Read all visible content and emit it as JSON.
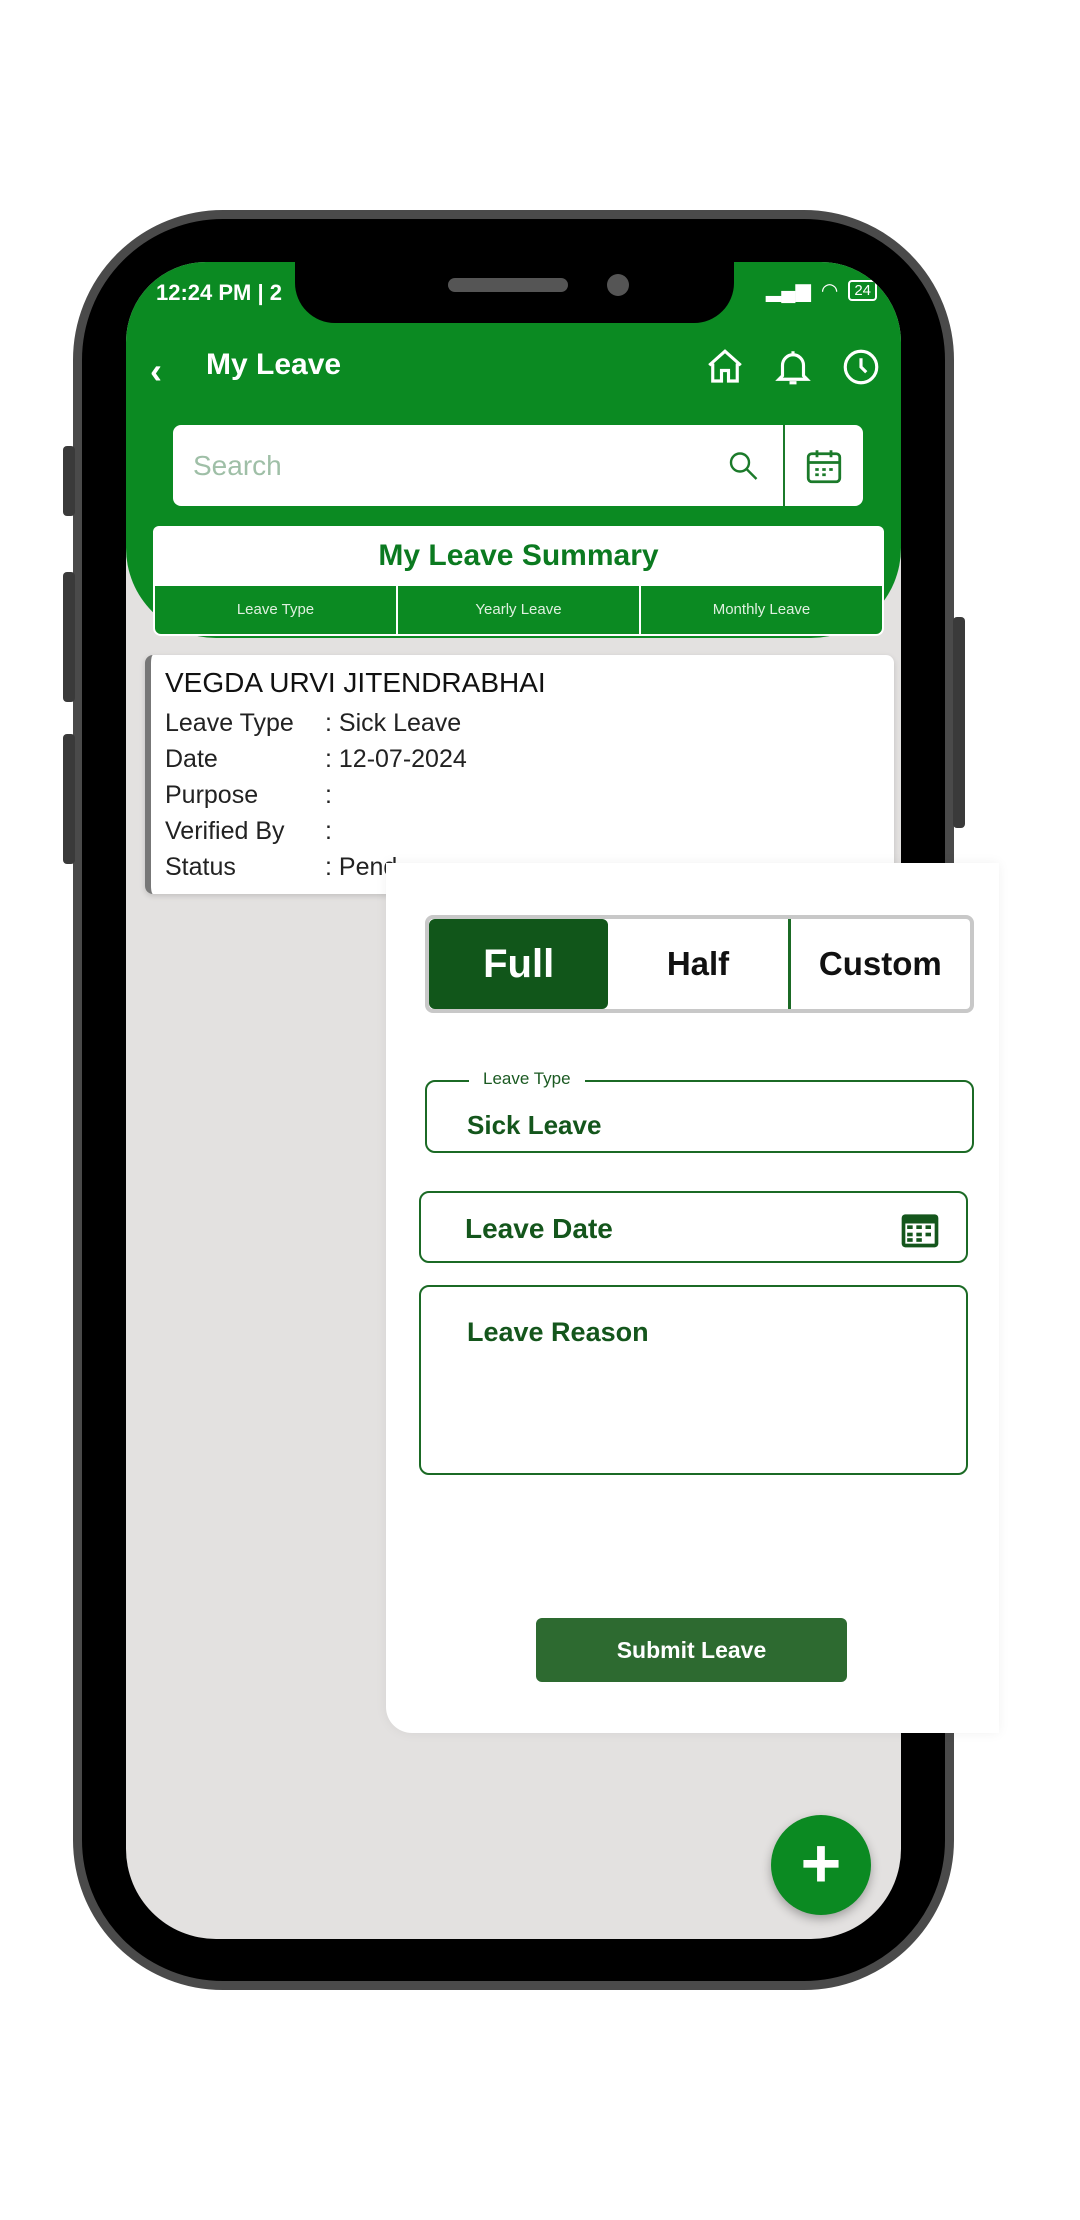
{
  "status_bar": {
    "time": "12:24 PM | 2",
    "battery": "24"
  },
  "header": {
    "title": "My Leave",
    "back_icon": "chevron-left-icon",
    "icons": [
      "home-icon",
      "bell-icon",
      "clock-icon"
    ]
  },
  "search": {
    "placeholder": "Search"
  },
  "summary": {
    "title": "My Leave Summary",
    "tabs": [
      "Leave Type",
      "Yearly Leave",
      "Monthly Leave"
    ]
  },
  "card": {
    "name": "VEGDA URVI JITENDRABHAI",
    "rows": [
      {
        "label": "Leave Type",
        "value": ": Sick Leave"
      },
      {
        "label": "Date",
        "value": ": 12-07-2024"
      },
      {
        "label": "Purpose",
        "value": ":"
      },
      {
        "label": "Verified By",
        "value": ":"
      },
      {
        "label": "Status",
        "value": ": Pend"
      }
    ]
  },
  "form": {
    "segments": [
      "Full",
      "Half",
      "Custom"
    ],
    "selected": "Full",
    "leave_type": {
      "label": "Leave Type",
      "value": "Sick Leave"
    },
    "leave_date": {
      "placeholder": "Leave Date"
    },
    "leave_reason": {
      "placeholder": "Leave Reason"
    },
    "submit": "Submit Leave"
  },
  "fab": "+",
  "colors": {
    "primary": "#0b8a22",
    "dark": "#11561a",
    "button": "#2d6a30"
  }
}
